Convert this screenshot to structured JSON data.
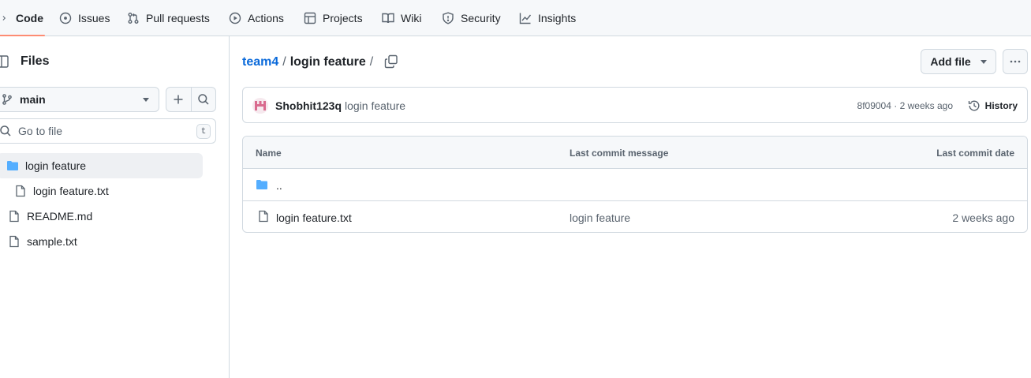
{
  "repo_nav": {
    "tabs": [
      {
        "label": "Code",
        "icon": "code-icon",
        "selected": true
      },
      {
        "label": "Issues",
        "icon": "issue-opened-icon",
        "selected": false
      },
      {
        "label": "Pull requests",
        "icon": "git-pull-request-icon",
        "selected": false
      },
      {
        "label": "Actions",
        "icon": "play-icon",
        "selected": false
      },
      {
        "label": "Projects",
        "icon": "table-icon",
        "selected": false
      },
      {
        "label": "Wiki",
        "icon": "book-icon",
        "selected": false
      },
      {
        "label": "Security",
        "icon": "shield-icon",
        "selected": false
      },
      {
        "label": "Insights",
        "icon": "graph-icon",
        "selected": false
      }
    ]
  },
  "sidebar": {
    "title": "Files",
    "branch": "main",
    "search_placeholder": "Go to file",
    "search_shortcut": "t",
    "tree": [
      {
        "label": "login feature",
        "type": "folder",
        "active": true
      },
      {
        "label": "login feature.txt",
        "type": "file",
        "active": false
      },
      {
        "label": "README.md",
        "type": "file",
        "active": false
      },
      {
        "label": "sample.txt",
        "type": "file",
        "active": false
      }
    ]
  },
  "breadcrumb": {
    "repo": "team4",
    "separator": "/",
    "current": "login feature",
    "trailing": "/"
  },
  "actions": {
    "add_file": "Add file",
    "more": "More options"
  },
  "latest_commit": {
    "author": "Shobhit123q",
    "message": "login feature",
    "sha": "8f09004",
    "dot": "·",
    "age": "2 weeks ago",
    "history_label": "History"
  },
  "file_table": {
    "headers": {
      "name": "Name",
      "message": "Last commit message",
      "date": "Last commit date"
    },
    "parent_dir": "..",
    "rows": [
      {
        "name": "login feature.txt",
        "message": "login feature",
        "date": "2 weeks ago"
      }
    ]
  },
  "colors": {
    "accent_link": "#0969da",
    "folder": "#54aeff",
    "selected_underline": "#fd8c73",
    "border": "#d1d9e0",
    "muted": "#59636e"
  }
}
